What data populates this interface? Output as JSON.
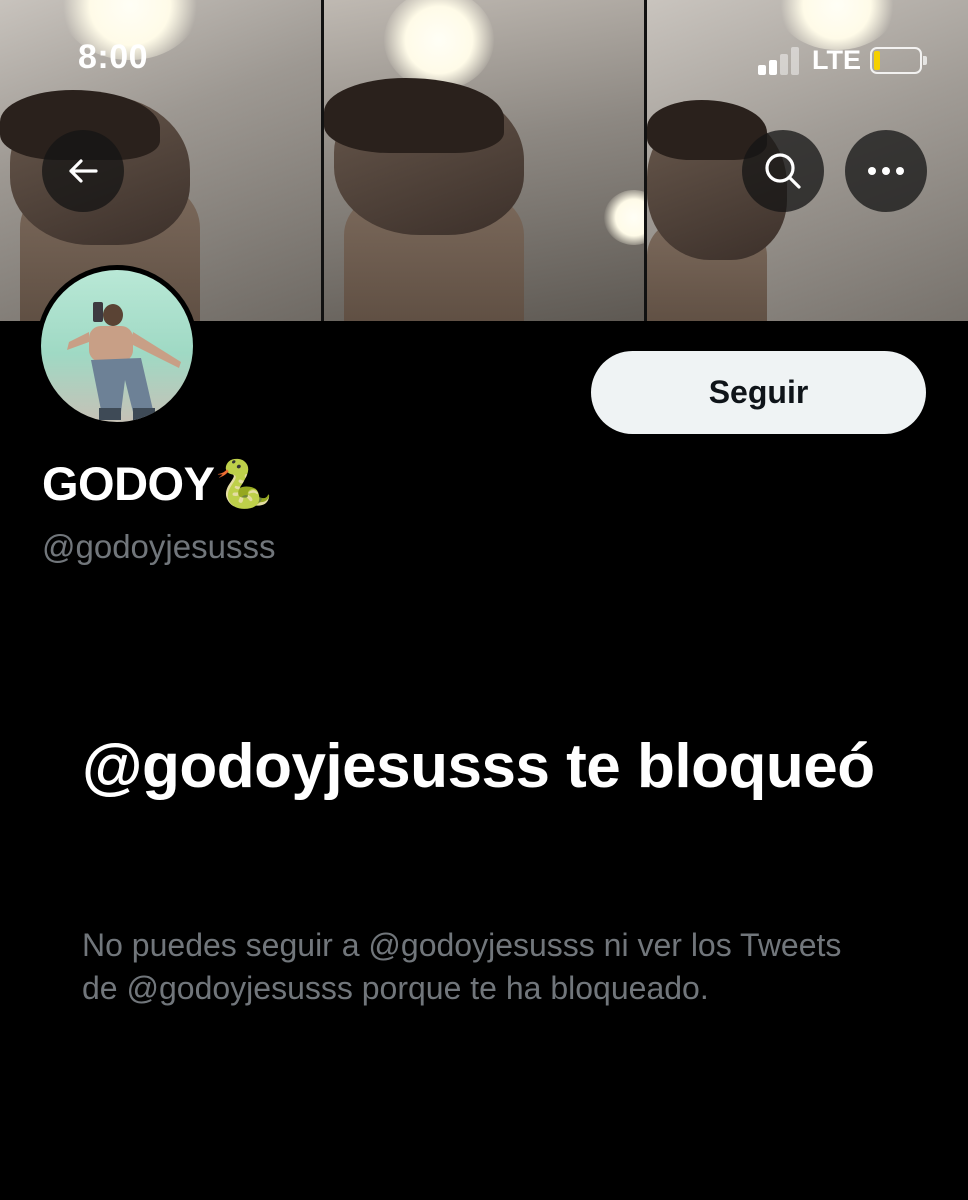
{
  "status_bar": {
    "time": "8:00",
    "network": "LTE"
  },
  "nav": {
    "back_icon": "arrow-left-icon",
    "search_icon": "search-icon",
    "more_icon": "more-horizontal-icon"
  },
  "profile": {
    "display_name": "GODOY🐍",
    "handle": "@godoyjesusss",
    "follow_label": "Seguir"
  },
  "blocked": {
    "title": "@godoyjesusss te bloqueó",
    "description": "No puedes seguir a @godoyjesusss ni ver los Tweets de @godoyjesusss porque te ha bloqueado."
  },
  "colors": {
    "background": "#000000",
    "primary_text": "#ffffff",
    "secondary_text": "#71767b",
    "button_bg": "#eff3f4",
    "battery": "#f5d000"
  }
}
